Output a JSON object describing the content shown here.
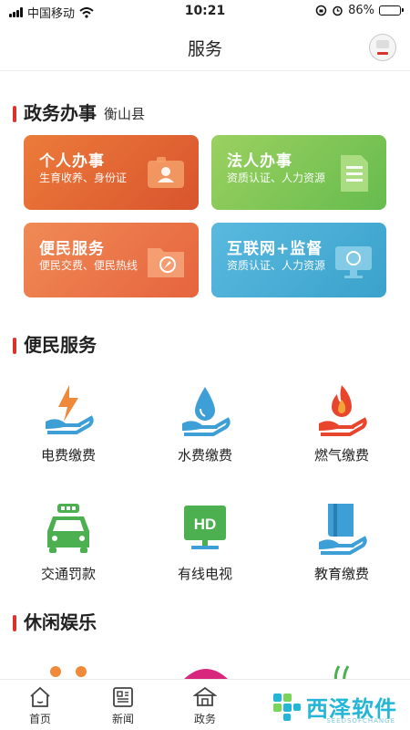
{
  "status_bar": {
    "carrier": "中国移动",
    "time": "10:21",
    "battery_percent": "86%",
    "battery_level": 0.86
  },
  "nav": {
    "title": "服务"
  },
  "gov_section": {
    "title": "政务办事",
    "location": "衡山县",
    "cards": [
      {
        "title": "个人办事",
        "desc": "生育收养、身份证",
        "icon": "id-card-icon",
        "color": "#e5673a"
      },
      {
        "title": "法人办事",
        "desc": "资质认证、人力资源",
        "icon": "document-icon",
        "color": "#7cc356"
      },
      {
        "title": "便民服务",
        "desc": "便民交费、便民热线",
        "icon": "folder-compass-icon",
        "color": "#ea7248"
      },
      {
        "title": "互联网+监督",
        "desc": "资质认证、人力资源",
        "icon": "monitor-icon",
        "color": "#47acd5"
      }
    ]
  },
  "service_section": {
    "title": "便民服务",
    "items": [
      {
        "label": "电费缴费",
        "icon": "electricity-hand-icon"
      },
      {
        "label": "水费缴费",
        "icon": "water-drop-hand-icon"
      },
      {
        "label": "燃气缴费",
        "icon": "gas-flame-hand-icon"
      },
      {
        "label": "交通罚款",
        "icon": "car-icon"
      },
      {
        "label": "有线电视",
        "icon": "tv-hd-icon"
      },
      {
        "label": "教育缴费",
        "icon": "book-hand-icon"
      }
    ]
  },
  "leisure_section": {
    "title": "休闲娱乐"
  },
  "tab_bar": {
    "tabs": [
      {
        "label": "首页",
        "icon": "home-icon"
      },
      {
        "label": "新闻",
        "icon": "news-icon"
      },
      {
        "label": "政务",
        "icon": "government-icon"
      }
    ]
  },
  "watermark": {
    "text": "西泽软件",
    "sub": "SEEDSOFCHANGE"
  },
  "colors": {
    "accent_red": "#d9342b",
    "icon_orange": "#f08a3a",
    "icon_blue": "#3d9fd6",
    "icon_green": "#4caf50"
  }
}
